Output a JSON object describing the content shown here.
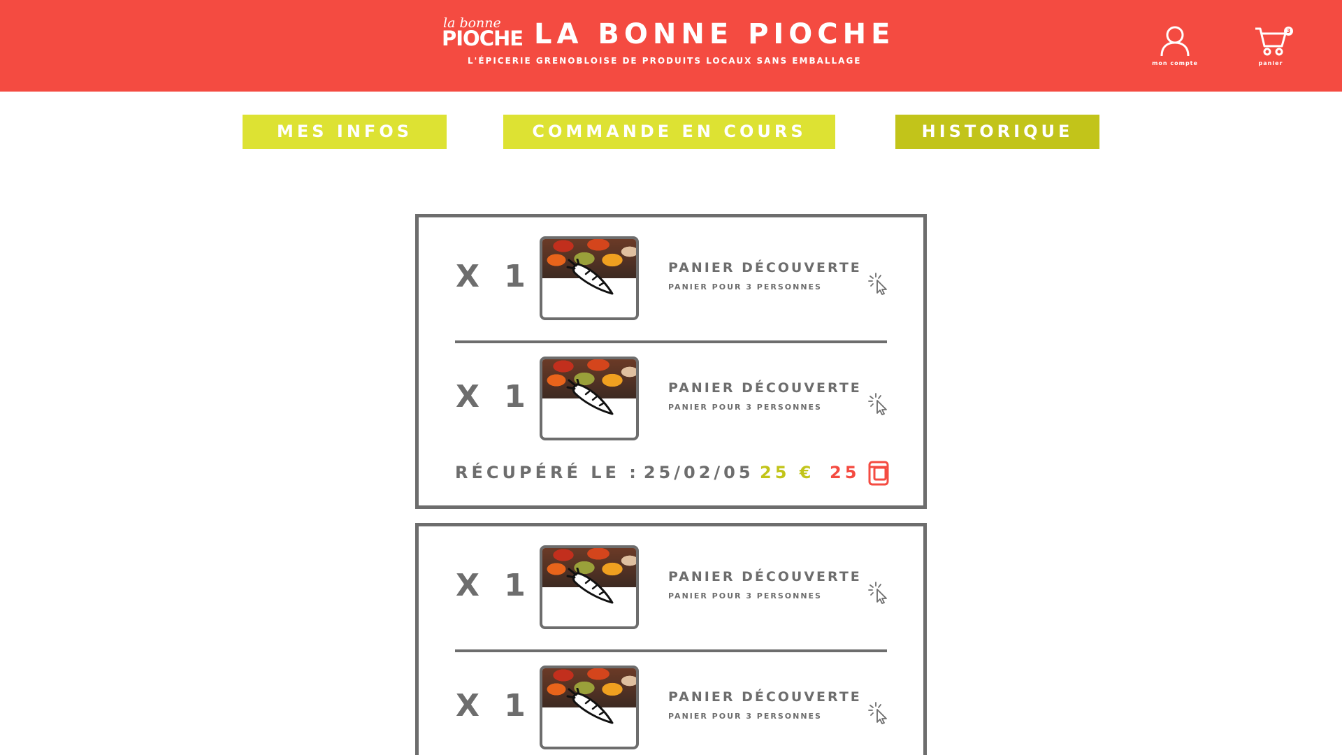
{
  "header": {
    "logo_script": "la bonne",
    "logo_word": "PIOCHE",
    "title": "LA BONNE PIOCHE",
    "subtitle": "L'ÉPICERIE GRENOBLOISE DE PRODUITS LOCAUX SANS EMBALLAGE",
    "account_label": "mon compte",
    "cart_label": "panier",
    "cart_count": "3",
    "account_icon": "user-icon",
    "cart_icon": "cart-icon"
  },
  "tabs": [
    {
      "label": "MES INFOS"
    },
    {
      "label": "COMMANDE EN COURS"
    },
    {
      "label": "HISTORIQUE",
      "active": true
    }
  ],
  "orders": [
    {
      "items": [
        {
          "qty": "X 1",
          "name": "PANIER DÉCOUVERTE",
          "desc": "PANIER POUR 3 PERSONNES"
        },
        {
          "qty": "X 1",
          "name": "PANIER DÉCOUVERTE",
          "desc": "PANIER POUR 3 PERSONNES"
        }
      ],
      "pickup_label": "RÉCUPÉRÉ LE :",
      "pickup_date": "25/02/05",
      "price": "25 €",
      "points": "25"
    },
    {
      "items": [
        {
          "qty": "X 1",
          "name": "PANIER DÉCOUVERTE",
          "desc": "PANIER POUR 3 PERSONNES"
        },
        {
          "qty": "X 1",
          "name": "PANIER DÉCOUVERTE",
          "desc": "PANIER POUR 3 PERSONNES"
        }
      ]
    }
  ],
  "colors": {
    "header_bg": "#f44b41",
    "tab_bg": "#dde233",
    "tab_active_bg": "#c2c41a",
    "text_grey": "#6d6d6d",
    "price_color": "#c2c41a",
    "points_color": "#f44b41"
  }
}
